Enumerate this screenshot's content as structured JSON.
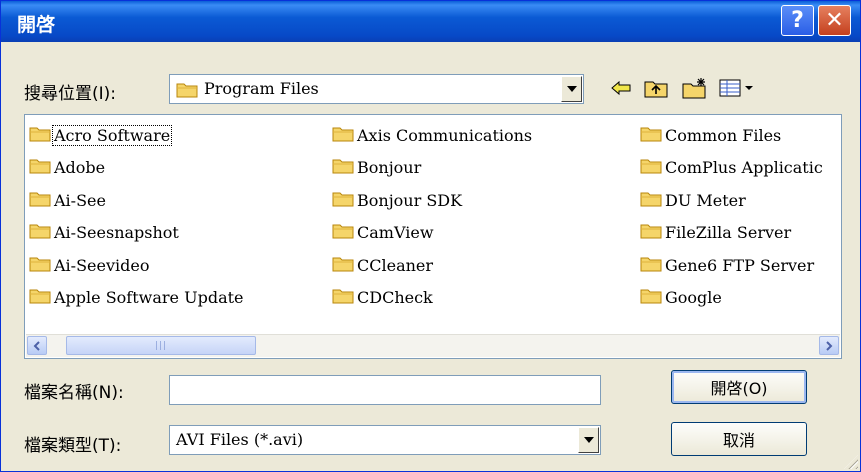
{
  "window": {
    "title": "開啓"
  },
  "titlebar": {
    "help_glyph": "?",
    "close_glyph": "✕"
  },
  "location": {
    "label": "搜尋位置(I):",
    "value": "Program Files"
  },
  "toolbar": {
    "icons": [
      "back-arrow-icon",
      "up-folder-icon",
      "new-folder-icon",
      "view-menu-icon"
    ]
  },
  "files": {
    "columns": [
      [
        "Acro Software",
        "Adobe",
        "Ai-See",
        "Ai-Seesnapshot",
        "Ai-Seevideo",
        "Apple Software Update"
      ],
      [
        "Axis Communications",
        "Bonjour",
        "Bonjour SDK",
        "CamView",
        "CCleaner",
        "CDCheck"
      ],
      [
        "Common Files",
        "ComPlus Applicatic",
        "DU Meter",
        "FileZilla Server",
        "Gene6 FTP Server",
        "Google"
      ]
    ]
  },
  "filename": {
    "label": "檔案名稱(N):",
    "value": ""
  },
  "filetype": {
    "label": "檔案類型(T):",
    "value": "AVI Files (*.avi)"
  },
  "buttons": {
    "open": "開啓(O)",
    "cancel": "取消"
  },
  "colors": {
    "title_bar": "#0a5fd8",
    "dialog_bg": "#ece9d8",
    "folder": "#f5d56a"
  }
}
